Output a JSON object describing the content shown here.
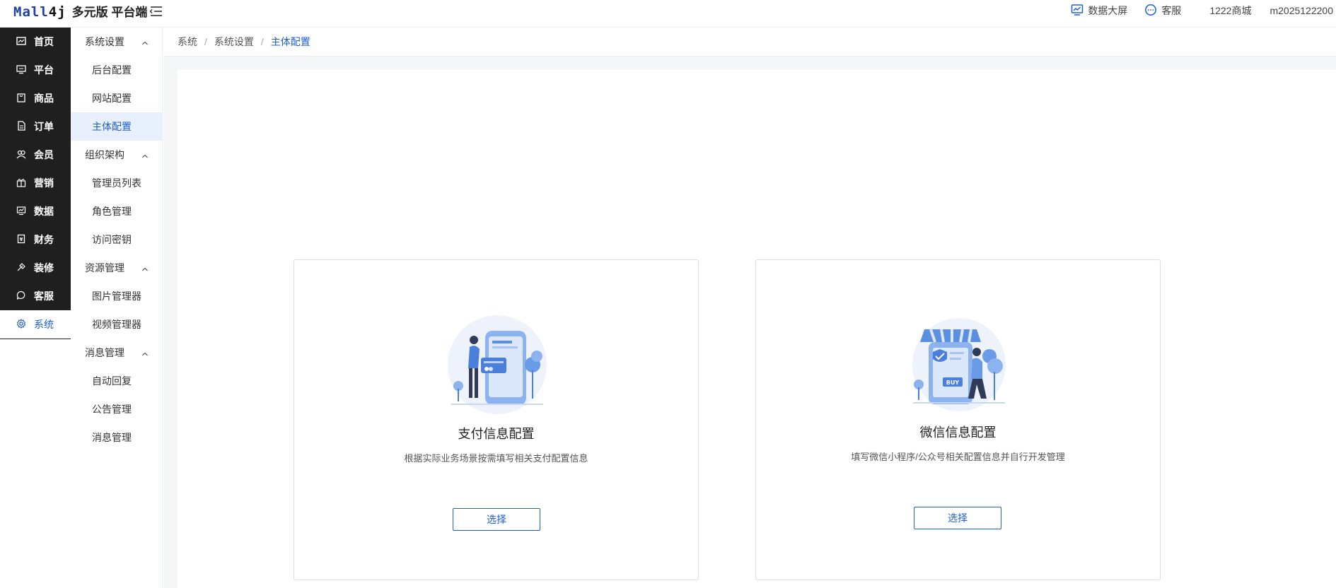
{
  "header": {
    "logo_mark": "Mall4j",
    "logo_text": "多元版 平台端",
    "data_screen": "数据大屏",
    "customer_service": "客服",
    "shop_name": "1222商城",
    "username": "m2025122200"
  },
  "main_nav": [
    {
      "label": "首页",
      "icon": "home-icon"
    },
    {
      "label": "平台",
      "icon": "monitor-icon"
    },
    {
      "label": "商品",
      "icon": "bag-icon"
    },
    {
      "label": "订单",
      "icon": "document-icon"
    },
    {
      "label": "会员",
      "icon": "users-icon"
    },
    {
      "label": "营销",
      "icon": "gift-icon"
    },
    {
      "label": "数据",
      "icon": "chart-icon"
    },
    {
      "label": "财务",
      "icon": "wallet-icon"
    },
    {
      "label": "装修",
      "icon": "brush-icon"
    },
    {
      "label": "客服",
      "icon": "chat-icon"
    },
    {
      "label": "系统",
      "icon": "gear-icon",
      "active": true
    }
  ],
  "sub_nav": {
    "groups": [
      {
        "label": "系统设置",
        "items": [
          "后台配置",
          "网站配置",
          "主体配置"
        ]
      },
      {
        "label": "组织架构",
        "items": [
          "管理员列表",
          "角色管理",
          "访问密钥"
        ]
      },
      {
        "label": "资源管理",
        "items": [
          "图片管理器",
          "视频管理器"
        ]
      },
      {
        "label": "消息管理",
        "items": [
          "自动回复",
          "公告管理",
          "消息管理"
        ]
      }
    ],
    "active_item": "主体配置"
  },
  "breadcrumb": [
    "系统",
    "系统设置",
    "主体配置"
  ],
  "cards": [
    {
      "title": "支付信息配置",
      "desc": "根据实际业务场景按需填写相关支付配置信息",
      "button": "选择",
      "illustration": "payment-illustration-icon"
    },
    {
      "title": "微信信息配置",
      "desc": "填写微信小程序/公众号相关配置信息并自行开发管理",
      "button": "选择",
      "illustration": "shop-illustration-icon"
    }
  ],
  "colors": {
    "accent": "#1d5fd6",
    "sidebar_dark": "#1f1f1f",
    "active_bg": "#e8f0fe"
  }
}
